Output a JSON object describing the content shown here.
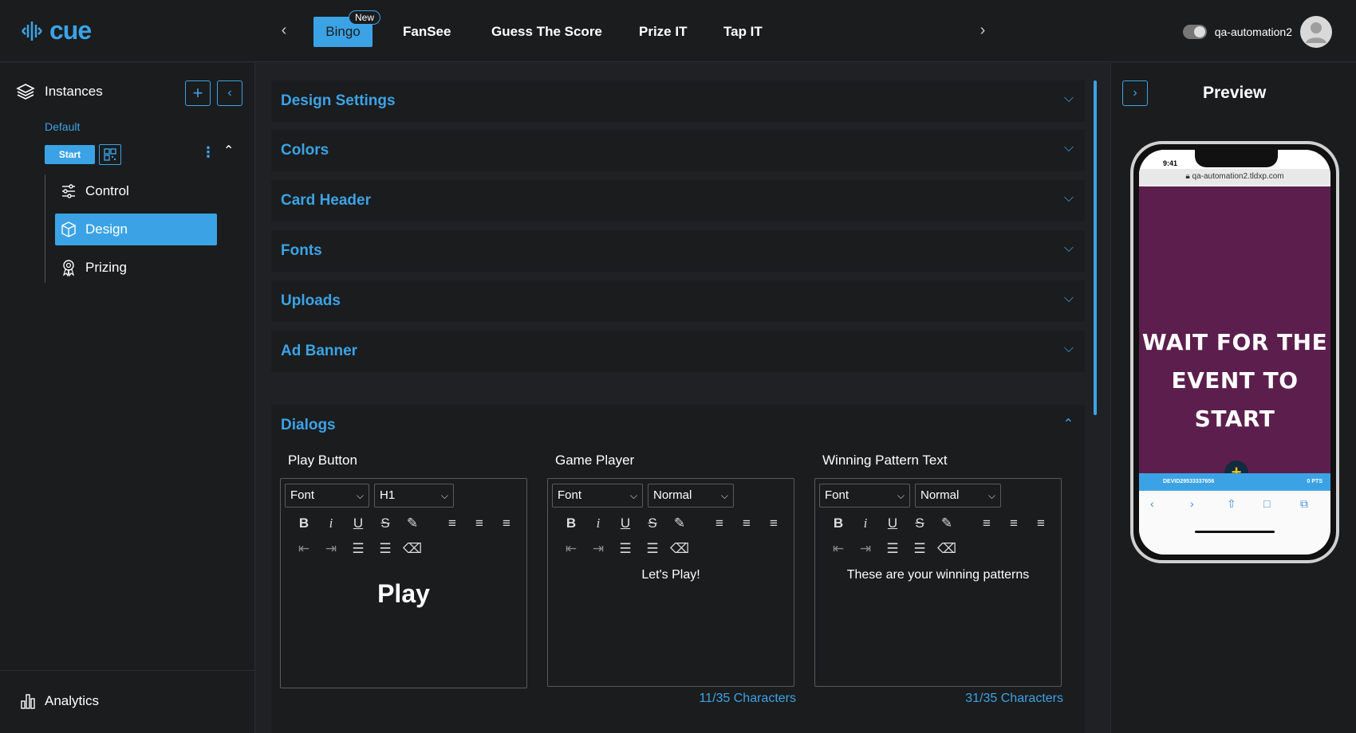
{
  "app": {
    "logo_text": "cue"
  },
  "nav": {
    "tabs": [
      {
        "label": "Bingo",
        "badge": "New"
      },
      {
        "label": "FanSee"
      },
      {
        "label": "Guess The Score"
      },
      {
        "label": "Prize IT"
      },
      {
        "label": "Tap IT"
      }
    ]
  },
  "user": {
    "name": "qa-automation2"
  },
  "sidebar": {
    "title": "Instances",
    "instance_name": "Default",
    "start_label": "Start",
    "items": [
      {
        "label": "Control",
        "icon": "sliders-icon"
      },
      {
        "label": "Design",
        "icon": "cube-icon"
      },
      {
        "label": "Prizing",
        "icon": "award-icon"
      }
    ],
    "footer_label": "Analytics"
  },
  "sections": [
    {
      "title": "Design Settings"
    },
    {
      "title": "Colors"
    },
    {
      "title": "Card Header"
    },
    {
      "title": "Fonts"
    },
    {
      "title": "Uploads"
    },
    {
      "title": "Ad Banner"
    }
  ],
  "dialogs": {
    "title": "Dialogs",
    "editors": [
      {
        "label": "Play Button",
        "font": "Font",
        "style": "H1",
        "content": "Play",
        "counter": ""
      },
      {
        "label": "Game Player",
        "font": "Font",
        "style": "Normal",
        "content": "Let's Play!",
        "counter": "11/35 Characters"
      },
      {
        "label": "Winning Pattern Text",
        "font": "Font",
        "style": "Normal",
        "content": "These are your winning patterns",
        "counter": "31/35 Characters"
      }
    ]
  },
  "preview": {
    "title": "Preview",
    "time": "9:41",
    "url": "qa-automation2.tldxp.com",
    "message_line1": "WAIT FOR THE",
    "message_line2": "EVENT TO START",
    "player_id": "DEVID29533337656",
    "points": "0 PTS"
  },
  "colors": {
    "accent": "#3ba3e5",
    "background": "#202124",
    "panel": "#1b1c1e",
    "event_bg": "#5c1f4d"
  }
}
